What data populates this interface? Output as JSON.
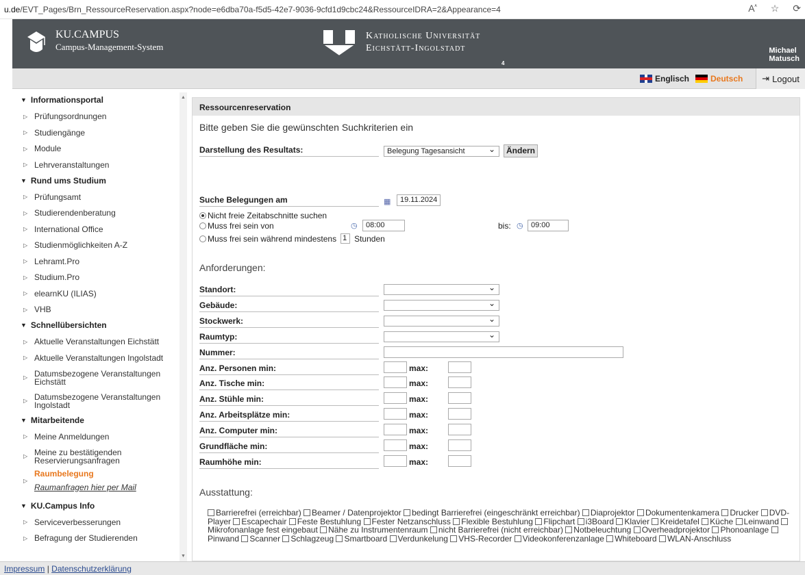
{
  "browser": {
    "url_prefix": "u.de",
    "url_rest": "/EVT_Pages/Brn_RessourceReservation.aspx?node=e6dba70a-f5d5-42e7-9036-9cfd1d9cbc24&RessourceIDRA=2&Appearance=4"
  },
  "header": {
    "campus_title": "KU.CAMPUS",
    "campus_subtitle": "Campus-Management-System",
    "university_line1": "Katholische Universität",
    "university_line2": "Eichstätt-Ingolstadt",
    "version": "4",
    "user_first": "Michael",
    "user_last": "Matusch"
  },
  "toolbar": {
    "lang_english": "Englisch",
    "lang_german": "Deutsch",
    "logout": "Logout",
    "german_color": "#e8781e"
  },
  "sidebar": [
    {
      "type": "cat",
      "label": "Informationsportal"
    },
    {
      "type": "item",
      "label": "Prüfungsordnungen"
    },
    {
      "type": "item",
      "label": "Studiengänge"
    },
    {
      "type": "item",
      "label": "Module"
    },
    {
      "type": "item",
      "label": "Lehrveranstaltungen"
    },
    {
      "type": "cat",
      "label": "Rund ums Studium"
    },
    {
      "type": "item",
      "label": "Prüfungsamt"
    },
    {
      "type": "item",
      "label": "Studierendenberatung"
    },
    {
      "type": "item",
      "label": "International Office"
    },
    {
      "type": "item",
      "label": "Studienmöglichkeiten A-Z"
    },
    {
      "type": "item",
      "label": "Lehramt.Pro"
    },
    {
      "type": "item",
      "label": "Studium.Pro"
    },
    {
      "type": "item",
      "label": "elearnKU (ILIAS)"
    },
    {
      "type": "item",
      "label": "VHB"
    },
    {
      "type": "cat",
      "label": "Schnellübersichten"
    },
    {
      "type": "item",
      "label": "Aktuelle Veranstaltungen Eichstätt"
    },
    {
      "type": "item",
      "label": "Aktuelle Veranstaltungen Ingolstadt"
    },
    {
      "type": "item2",
      "label": "Datumsbezogene Veranstaltungen",
      "label2": "Eichstätt"
    },
    {
      "type": "item2",
      "label": "Datumsbezogene Veranstaltungen",
      "label2": "Ingolstadt"
    },
    {
      "type": "cat",
      "label": "Mitarbeitende"
    },
    {
      "type": "item",
      "label": "Meine Anmeldungen"
    },
    {
      "type": "item2",
      "label": "Meine zu bestätigenden",
      "label2": "Reservierungsanfragen"
    },
    {
      "type": "active",
      "label": "Raumbelegung",
      "label2": "Raumanfragen hier per Mail"
    },
    {
      "type": "cat",
      "label": "KU.Campus Info"
    },
    {
      "type": "item",
      "label": "Serviceverbesserungen"
    },
    {
      "type": "item",
      "label": "Befragung der Studierenden"
    }
  ],
  "main": {
    "title": "Ressourcenreservation",
    "intro": "Bitte geben Sie die gewünschten Suchkriterien ein",
    "display_label": "Darstellung des Resultats:",
    "display_value": "Belegung Tagesansicht",
    "change_button": "Ändern",
    "search_label": "Suche Belegungen am",
    "search_date": "19.11.2024",
    "radio1": "Nicht freie Zeitabschnitte suchen",
    "radio2": "Muss frei sein von",
    "time_from": "08:00",
    "until_label": "bis:",
    "time_to": "09:00",
    "radio3": "Muss frei sein während mindestens",
    "hours_value": "1",
    "hours_label": "Stunden",
    "requirements": "Anforderungen:",
    "req_selects": [
      "Standort:",
      "Gebäude:",
      "Stockwerk:",
      "Raumtyp:"
    ],
    "number_label": "Nummer:",
    "minmax": [
      "Anz. Personen min:",
      "Anz. Tische min:",
      "Anz. Stühle min:",
      "Anz. Arbeitsplätze min:",
      "Anz. Computer min:",
      "Grundfläche min:",
      "Raumhöhe min:"
    ],
    "max_label": "max:",
    "equipment": "Ausstattung:",
    "amenities": [
      "Barrierefrei (erreichbar)",
      "Beamer / Datenprojektor",
      "bedingt Barrierefrei (eingeschränkt erreichbar)",
      "Diaprojektor",
      "Dokumentenkamera",
      "Drucker",
      "DVD-Player",
      "Escapechair",
      "Feste Bestuhlung",
      "Fester Netzanschluss",
      "Flexible Bestuhlung",
      "Flipchart",
      "i3Board",
      "Klavier",
      "Kreidetafel",
      "Küche",
      "Leinwand",
      "Mikrofonanlage fest eingebaut",
      "Nähe zu Instrumentenraum",
      "nicht Barrierefrei (nicht erreichbar)",
      "Notbeleuchtung",
      "Overheadprojektor",
      "Phonoanlage",
      "Pinwand",
      "Scanner",
      "Schlagzeug",
      "Smartboard",
      "Verdunkelung",
      "VHS-Recorder",
      "Videokonferenzanlage",
      "Whiteboard",
      "WLAN-Anschluss"
    ]
  },
  "footer": {
    "impressum": "Impressum",
    "sep": "|",
    "privacy": "Datenschutzerklärung"
  }
}
